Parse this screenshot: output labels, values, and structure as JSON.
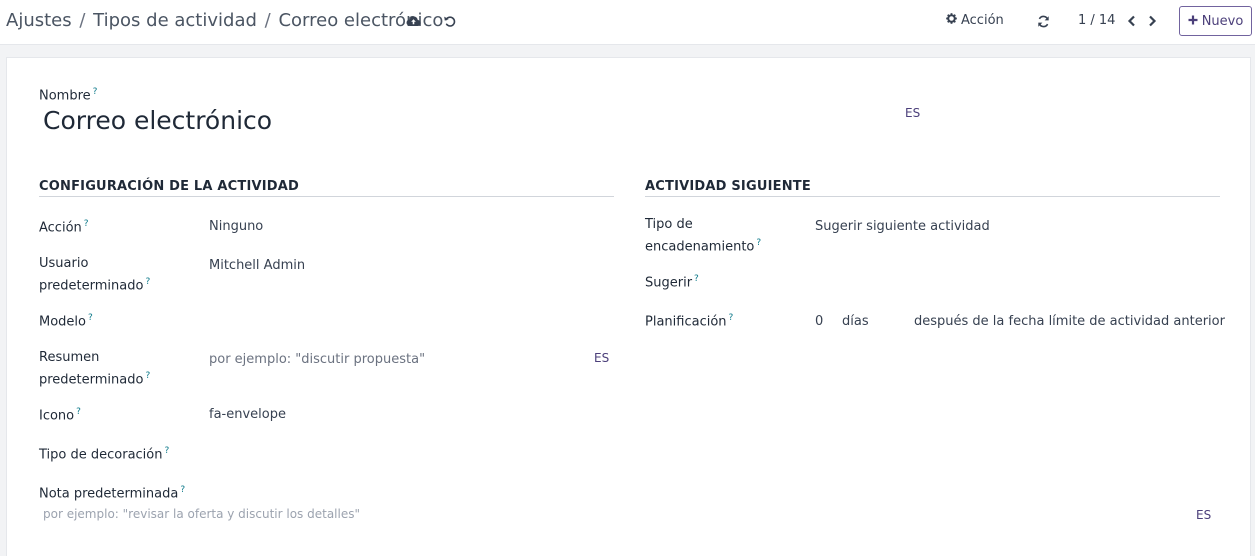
{
  "breadcrumb": {
    "items": [
      "Ajustes",
      "Tipos de actividad"
    ],
    "current": "Correo electrónico",
    "separator": "/"
  },
  "toolbar": {
    "action_label": "Acción",
    "pager": "1 / 14",
    "new_label": "Nuevo"
  },
  "form": {
    "name_label": "Nombre",
    "name_value": "Correo electrónico",
    "lang_badge": "ES",
    "help_mark": "?",
    "left_section": {
      "title": "CONFIGURACIÓN DE LA ACTIVIDAD",
      "accion_label": "Acción",
      "accion_value": "Ninguno",
      "usuario_label_1": "Usuario",
      "usuario_label_2": "predeterminado",
      "usuario_value": "Mitchell Admin",
      "modelo_label": "Modelo",
      "resumen_label_1": "Resumen",
      "resumen_label_2": "predeterminado",
      "resumen_placeholder": "por ejemplo:  \"discutir propuesta\"",
      "resumen_lang": "ES",
      "icono_label": "Icono",
      "icono_value": "fa-envelope",
      "decoracion_label": "Tipo de decoración",
      "nota_label": "Nota predeterminada",
      "nota_placeholder": "por ejemplo: \"revisar la oferta y discutir los detalles\"",
      "nota_lang": "ES"
    },
    "right_section": {
      "title": "ACTIVIDAD SIGUIENTE",
      "tipo_label_1": "Tipo de",
      "tipo_label_2": "encadenamiento",
      "tipo_value": "Sugerir siguiente actividad",
      "sugerir_label": "Sugerir",
      "planificacion_label": "Planificación",
      "plan_number": "0",
      "plan_unit": "días",
      "plan_trigger": "después de la fecha límite de actividad anterior"
    }
  }
}
